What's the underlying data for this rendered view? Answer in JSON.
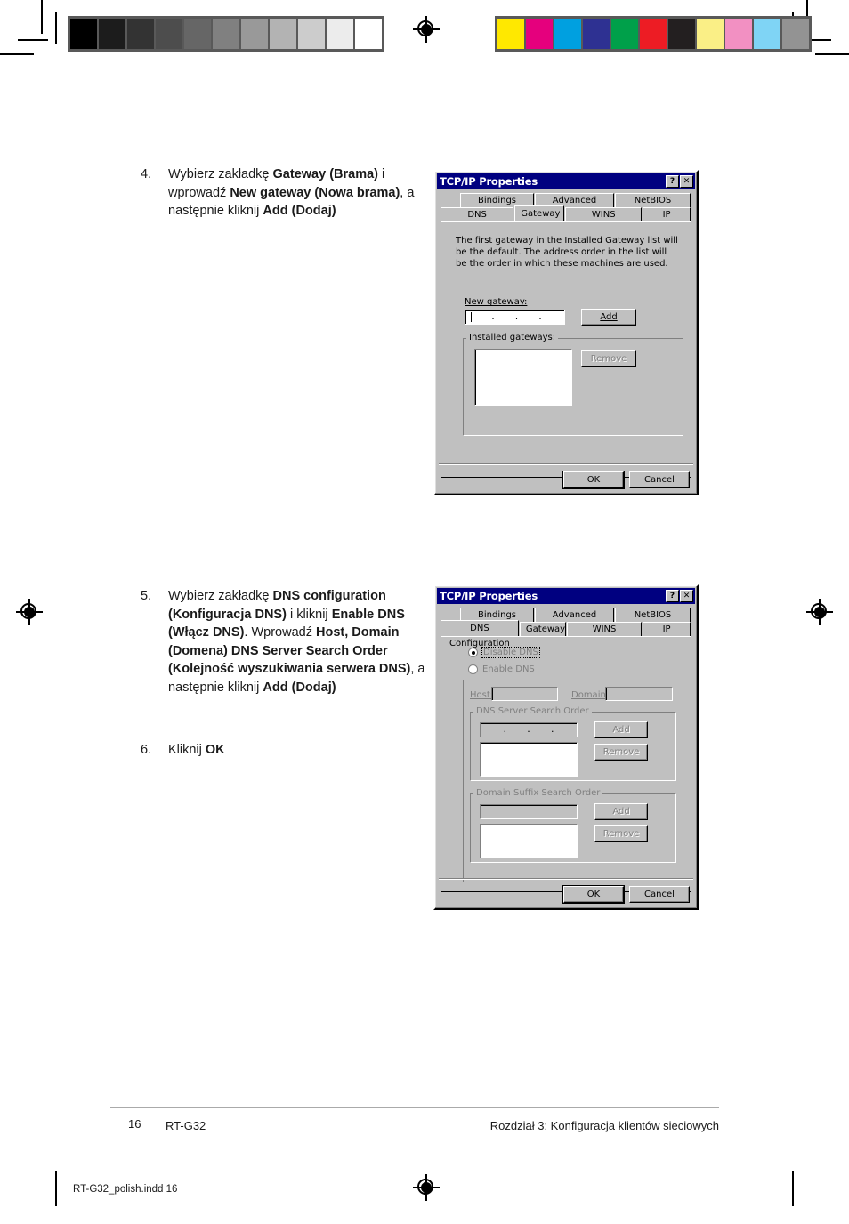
{
  "page": {
    "number": "16",
    "product": "RT-G32",
    "chapter": "Rozdział 3: Konfiguracja klientów sieciowych",
    "imprint": "RT-G32_polish.indd   16"
  },
  "calibration": {
    "grayscale": [
      "#000000",
      "#1c1c1c",
      "#333333",
      "#4d4d4d",
      "#666666",
      "#808080",
      "#999999",
      "#b3b3b3",
      "#cccccc",
      "#ececec",
      "#ffffff"
    ],
    "colors": [
      "#ffe800",
      "#e5007d",
      "#00a0e0",
      "#2e3192",
      "#00a04a",
      "#ed1c24",
      "#231f20",
      "#faef86",
      "#f290c2",
      "#7fd4f5",
      "#939393"
    ]
  },
  "steps": [
    {
      "number": "4.",
      "parts": [
        {
          "text": "Wybierz zakładkę ",
          "bold": false
        },
        {
          "text": "Gateway (Brama)",
          "bold": true
        },
        {
          "text": " i wprowadź ",
          "bold": false
        },
        {
          "text": "New gateway (Nowa brama)",
          "bold": true
        },
        {
          "text": ", a następnie kliknij ",
          "bold": false
        },
        {
          "text": "Add (Dodaj)",
          "bold": true
        }
      ]
    },
    {
      "number": "5.",
      "parts": [
        {
          "text": "Wybierz zakładkę ",
          "bold": false
        },
        {
          "text": "DNS configuration (Konfiguracja DNS)",
          "bold": true
        },
        {
          "text": " i kliknij ",
          "bold": false
        },
        {
          "text": "Enable DNS (Włącz DNS)",
          "bold": true
        },
        {
          "text": ". Wprowadź ",
          "bold": false
        },
        {
          "text": "Host, Domain (Domena)   DNS Server Search Order (Kolejność wyszukiwania serwera DNS)",
          "bold": true
        },
        {
          "text": ", a następnie kliknij ",
          "bold": false
        },
        {
          "text": "Add (Dodaj)",
          "bold": true
        }
      ]
    },
    {
      "number": "6.",
      "parts": [
        {
          "text": "Kliknij ",
          "bold": false
        },
        {
          "text": "OK",
          "bold": true
        }
      ]
    }
  ],
  "dialog_gateway": {
    "title": "TCP/IP Properties",
    "help_button": "?",
    "close_button": "✕",
    "tabs_row1": [
      "Bindings",
      "Advanced",
      "NetBIOS"
    ],
    "tabs_row2": [
      "DNS Configuration",
      "Gateway",
      "WINS Configuration",
      "IP Address"
    ],
    "active_tab": "Gateway",
    "description": "The first gateway in the Installed Gateway list will be the default. The address order in the list will be the order in which these machines are used.",
    "new_gateway_label": "New gateway:",
    "new_gateway_value": "",
    "add_button": "Add",
    "installed_gateways_label": "Installed gateways:",
    "installed_gateways_items": [],
    "remove_button": "Remove",
    "ok_button": "OK",
    "cancel_button": "Cancel"
  },
  "dialog_dns": {
    "title": "TCP/IP Properties",
    "help_button": "?",
    "close_button": "✕",
    "tabs_row1": [
      "Bindings",
      "Advanced",
      "NetBIOS"
    ],
    "tabs_row2": [
      "DNS Configuration",
      "Gateway",
      "WINS Configuration",
      "IP Address"
    ],
    "active_tab": "DNS Configuration",
    "disable_dns_label": "Disable DNS",
    "enable_dns_label": "Enable DNS",
    "selected_radio": "Disable DNS",
    "host_label": "Host:",
    "host_value": "",
    "domain_label": "Domain:",
    "domain_value": "",
    "dns_search_group": "DNS Server Search Order",
    "dns_search_value": "",
    "dns_add_button": "Add",
    "dns_remove_button": "Remove",
    "dns_list_items": [],
    "suffix_group": "Domain Suffix Search Order",
    "suffix_value": "",
    "suffix_add_button": "Add",
    "suffix_remove_button": "Remove",
    "suffix_list_items": [],
    "ok_button": "OK",
    "cancel_button": "Cancel"
  },
  "colors": {
    "titlebar": "#000080",
    "dialog_face": "#c0c0c0",
    "disabled_text": "#808080"
  }
}
